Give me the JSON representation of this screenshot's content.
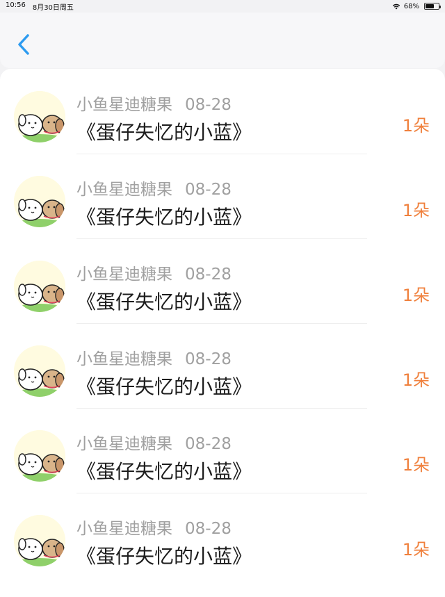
{
  "status_bar": {
    "time": "10:56",
    "date": "8月30日周五",
    "battery_percent": "68%",
    "battery_level": 0.68
  },
  "header": {
    "back_icon": "chevron-left-icon",
    "accent_color": "#2d9bf0"
  },
  "items": [
    {
      "username": "小鱼星迪糖果",
      "date": "08-28",
      "title": "《蛋仔失忆的小蓝》",
      "count": "1朵"
    },
    {
      "username": "小鱼星迪糖果",
      "date": "08-28",
      "title": "《蛋仔失忆的小蓝》",
      "count": "1朵"
    },
    {
      "username": "小鱼星迪糖果",
      "date": "08-28",
      "title": "《蛋仔失忆的小蓝》",
      "count": "1朵"
    },
    {
      "username": "小鱼星迪糖果",
      "date": "08-28",
      "title": "《蛋仔失忆的小蓝》",
      "count": "1朵"
    },
    {
      "username": "小鱼星迪糖果",
      "date": "08-28",
      "title": "《蛋仔失忆的小蓝》",
      "count": "1朵"
    },
    {
      "username": "小鱼星迪糖果",
      "date": "08-28",
      "title": "《蛋仔失忆的小蓝》",
      "count": "1朵"
    }
  ],
  "colors": {
    "count": "#f0803c",
    "meta": "#a0a0a0"
  }
}
